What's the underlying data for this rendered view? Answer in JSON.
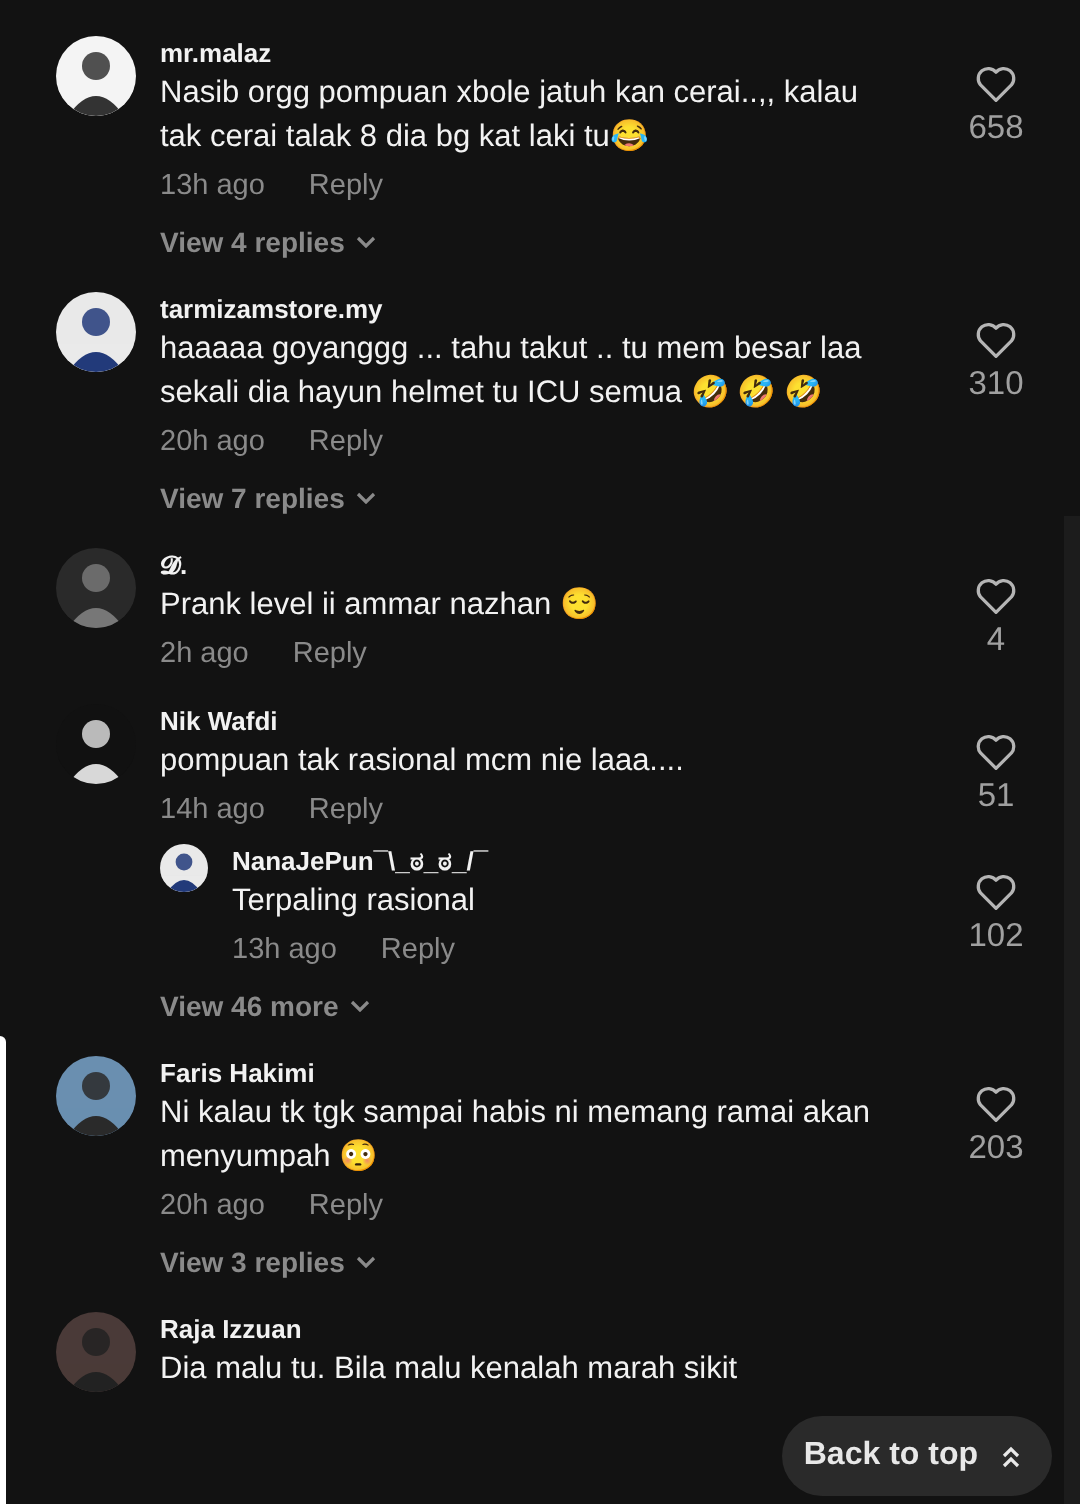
{
  "comments": [
    {
      "author": "mr.malaz",
      "text": "Nasib orgg pompuan xbole jatuh kan cerai..,, kalau tak cerai talak 8 dia bg kat laki tu😂",
      "time": "13h ago",
      "reply": "Reply",
      "likes": "658",
      "view_more": "View 4 replies"
    },
    {
      "author": "tarmizamstore.my",
      "text": "haaaaa goyanggg ... tahu takut .. tu mem besar laa sekali dia hayun helmet tu ICU semua 🤣 🤣 🤣",
      "time": "20h ago",
      "reply": "Reply",
      "likes": "310",
      "view_more": "View 7 replies"
    },
    {
      "author": "𝓓.",
      "text": "Prank level ii ammar nazhan 😌",
      "time": "2h ago",
      "reply": "Reply",
      "likes": "4"
    },
    {
      "author": "Nik Wafdi",
      "text": "pompuan tak rasional mcm nie laaa....",
      "time": "14h ago",
      "reply": "Reply",
      "likes": "51",
      "view_more": "View 46 more",
      "replies": [
        {
          "author": "NanaJePun¯\\_ಠ_ಠ_/¯",
          "text": "Terpaling rasional",
          "time": "13h ago",
          "reply": "Reply",
          "likes": "102"
        }
      ]
    },
    {
      "author": "Faris Hakimi",
      "text": "Ni kalau tk tgk sampai habis ni memang ramai akan menyumpah 😳",
      "time": "20h ago",
      "reply": "Reply",
      "likes": "203",
      "view_more": "View 3 replies"
    },
    {
      "author": "Raja Izzuan",
      "text": "Dia malu tu. Bila malu kenalah marah sikit"
    }
  ],
  "back_to_top": "Back to top"
}
